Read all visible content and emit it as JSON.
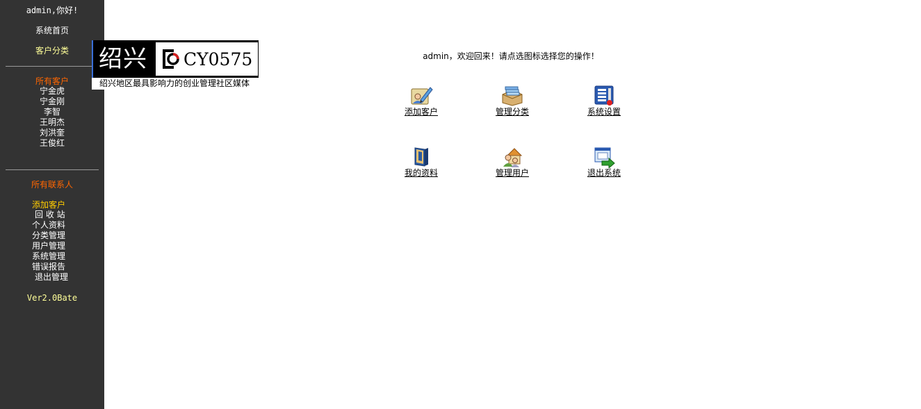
{
  "sidebar": {
    "greeting": "admin,你好!",
    "home": "系统首页",
    "category": "客户分类",
    "all_customers": "所有客户",
    "customers": [
      "宁金虎",
      "宁金刚",
      "李智",
      "王明杰",
      "刘洪奎",
      "王俊红"
    ],
    "all_contacts": "所有联系人",
    "add_customer": "添加客户",
    "menu": [
      "回 收 站",
      "个人资料",
      "分类管理",
      "用户管理",
      "系统管理",
      "错误报告",
      "退出管理"
    ],
    "version": "Ver2.0Bate"
  },
  "logo": {
    "city": "绍兴",
    "code": "CY0575",
    "tagline": "绍兴地区最具影响力的创业管理社区媒体"
  },
  "main": {
    "welcome": "admin，欢迎回来！请点选图标选择您的操作！",
    "actions": [
      {
        "label": "添加客户",
        "icon": "add-customer-icon"
      },
      {
        "label": "管理分类",
        "icon": "manage-category-icon"
      },
      {
        "label": "系统设置",
        "icon": "system-settings-icon"
      },
      {
        "label": "我的资料",
        "icon": "my-profile-icon"
      },
      {
        "label": "管理用户",
        "icon": "manage-users-icon"
      },
      {
        "label": "退出系统",
        "icon": "logout-icon"
      }
    ]
  },
  "colors": {
    "sidebar_bg": "#333333",
    "highlight_orange": "#ff6600",
    "highlight_yellow": "#ffff99",
    "highlight_gold": "#ffcc00"
  }
}
